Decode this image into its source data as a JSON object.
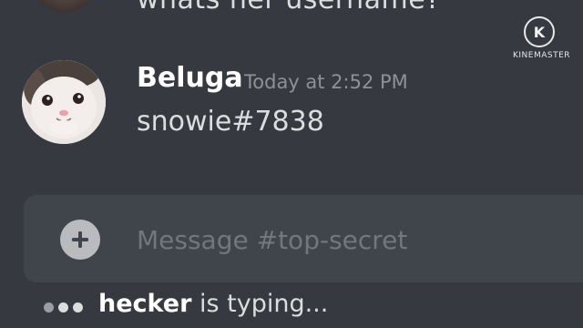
{
  "previous_message": {
    "text": "whats her username?"
  },
  "watermark": {
    "logo_icon": "kinemaster-logo-icon",
    "logo_letter": "K",
    "text": "KINEMASTER"
  },
  "message": {
    "author": "Beluga",
    "timestamp": "Today at 2:52 PM",
    "content": "snowie#7838",
    "avatar_icon": "cat-avatar"
  },
  "composer": {
    "placeholder": "Message #top-secret",
    "add_icon": "plus-circle-icon",
    "add_symbol": "+"
  },
  "typing": {
    "user": "hecker",
    "suffix": " is typing..."
  },
  "colors": {
    "background": "#36393f",
    "composer": "#40444b",
    "timestamp": "#8e9297",
    "text": "#dcddde",
    "placeholder": "#72767d"
  }
}
